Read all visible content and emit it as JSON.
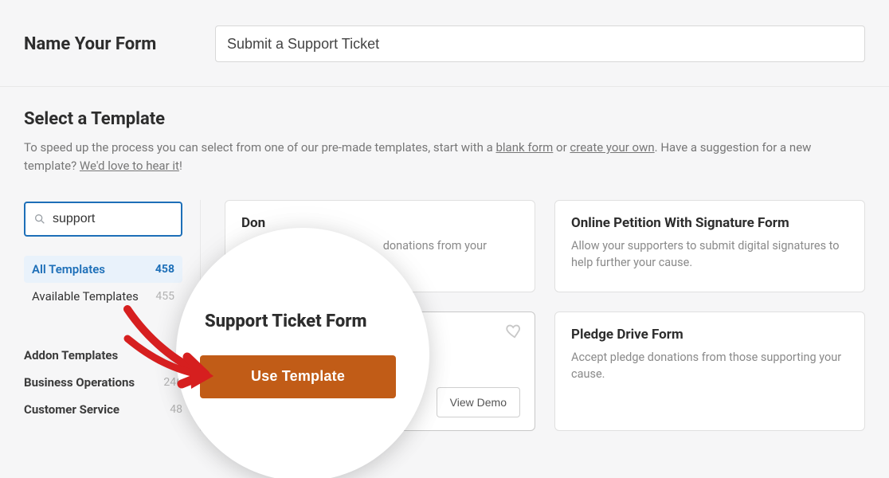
{
  "header": {
    "name_label": "Name Your Form",
    "name_value": "Submit a Support Ticket"
  },
  "select": {
    "title": "Select a Template",
    "desc_pre": "To speed up the process you can select from one of our pre-made templates, start with a ",
    "blank_form": "blank form",
    "or": " or ",
    "create_your_own": "create your own",
    "desc_mid": ". Have a suggestion for a new template? ",
    "love_to_hear": "We'd love to hear it",
    "exclaim": "!"
  },
  "sidebar": {
    "search_value": "support",
    "search_placeholder": "Search",
    "filters": [
      {
        "label": "All Templates",
        "count": "458",
        "active": true
      },
      {
        "label": "Available Templates",
        "count": "455",
        "active": false
      }
    ],
    "categories": [
      {
        "label": "Addon Templates",
        "count": ""
      },
      {
        "label": "Business Operations",
        "count": "246"
      },
      {
        "label": "Customer Service",
        "count": "48"
      }
    ]
  },
  "templates": {
    "card0": {
      "title_partial": "Don",
      "desc_partial": " donations from your"
    },
    "card1": {
      "title": "Online Petition With Signature Form",
      "desc": "Allow your supporters to submit digital signatures to help further your cause."
    },
    "card2": {
      "view_demo": "View Demo"
    },
    "card3": {
      "title": "Pledge Drive Form",
      "desc": "Accept pledge donations from those supporting your cause."
    }
  },
  "lens": {
    "title": "Support Ticket Form",
    "use_template": "Use Template"
  }
}
